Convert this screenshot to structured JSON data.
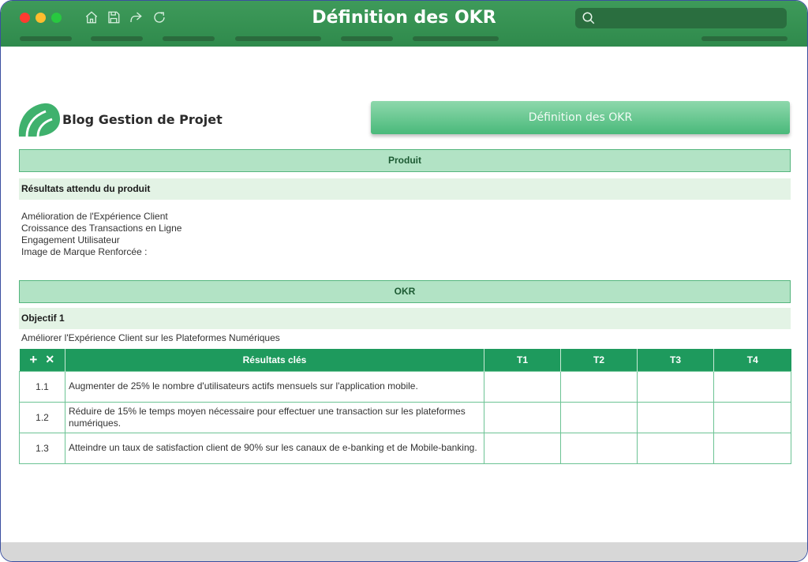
{
  "window": {
    "title": "Définition des OKR",
    "search_placeholder": ""
  },
  "toolbar": {
    "icons": [
      "home-icon",
      "save-icon",
      "share-icon",
      "refresh-icon"
    ]
  },
  "logo": {
    "text": "Blog Gestion de Projet"
  },
  "header_button": "Définition des OKR",
  "produit": {
    "title": "Produit",
    "subtitle": "Résultats attendu du produit",
    "items": [
      "Amélioration de l'Expérience Client",
      "Croissance des Transactions en Ligne",
      "Engagement Utilisateur",
      "Image de Marque Renforcée :"
    ]
  },
  "okr": {
    "title": "OKR",
    "objective_label": "Objectif 1",
    "objective_desc": "Améliorer l'Expérience Client sur les Plateformes Numériques",
    "table": {
      "add_label": "+",
      "remove_label": "✕",
      "headers": [
        "Résultats clés",
        "T1",
        "T2",
        "T3",
        "T4"
      ],
      "rows": [
        {
          "num": "1.1",
          "text": "Augmenter de 25% le nombre d'utilisateurs actifs mensuels sur l'application mobile."
        },
        {
          "num": "1.2",
          "text": "Réduire de 15% le temps moyen nécessaire pour effectuer une transaction sur les plateformes numériques."
        },
        {
          "num": "1.3",
          "text": "Atteindre un taux de satisfaction client de 90% sur les canaux de e-banking et de Mobile-banking."
        }
      ]
    }
  },
  "colors": {
    "titlebar": "#3e9a5a",
    "band": "#b2e3c5",
    "table_header": "#1e9a5d",
    "sub_band": "#e3f3e5"
  }
}
